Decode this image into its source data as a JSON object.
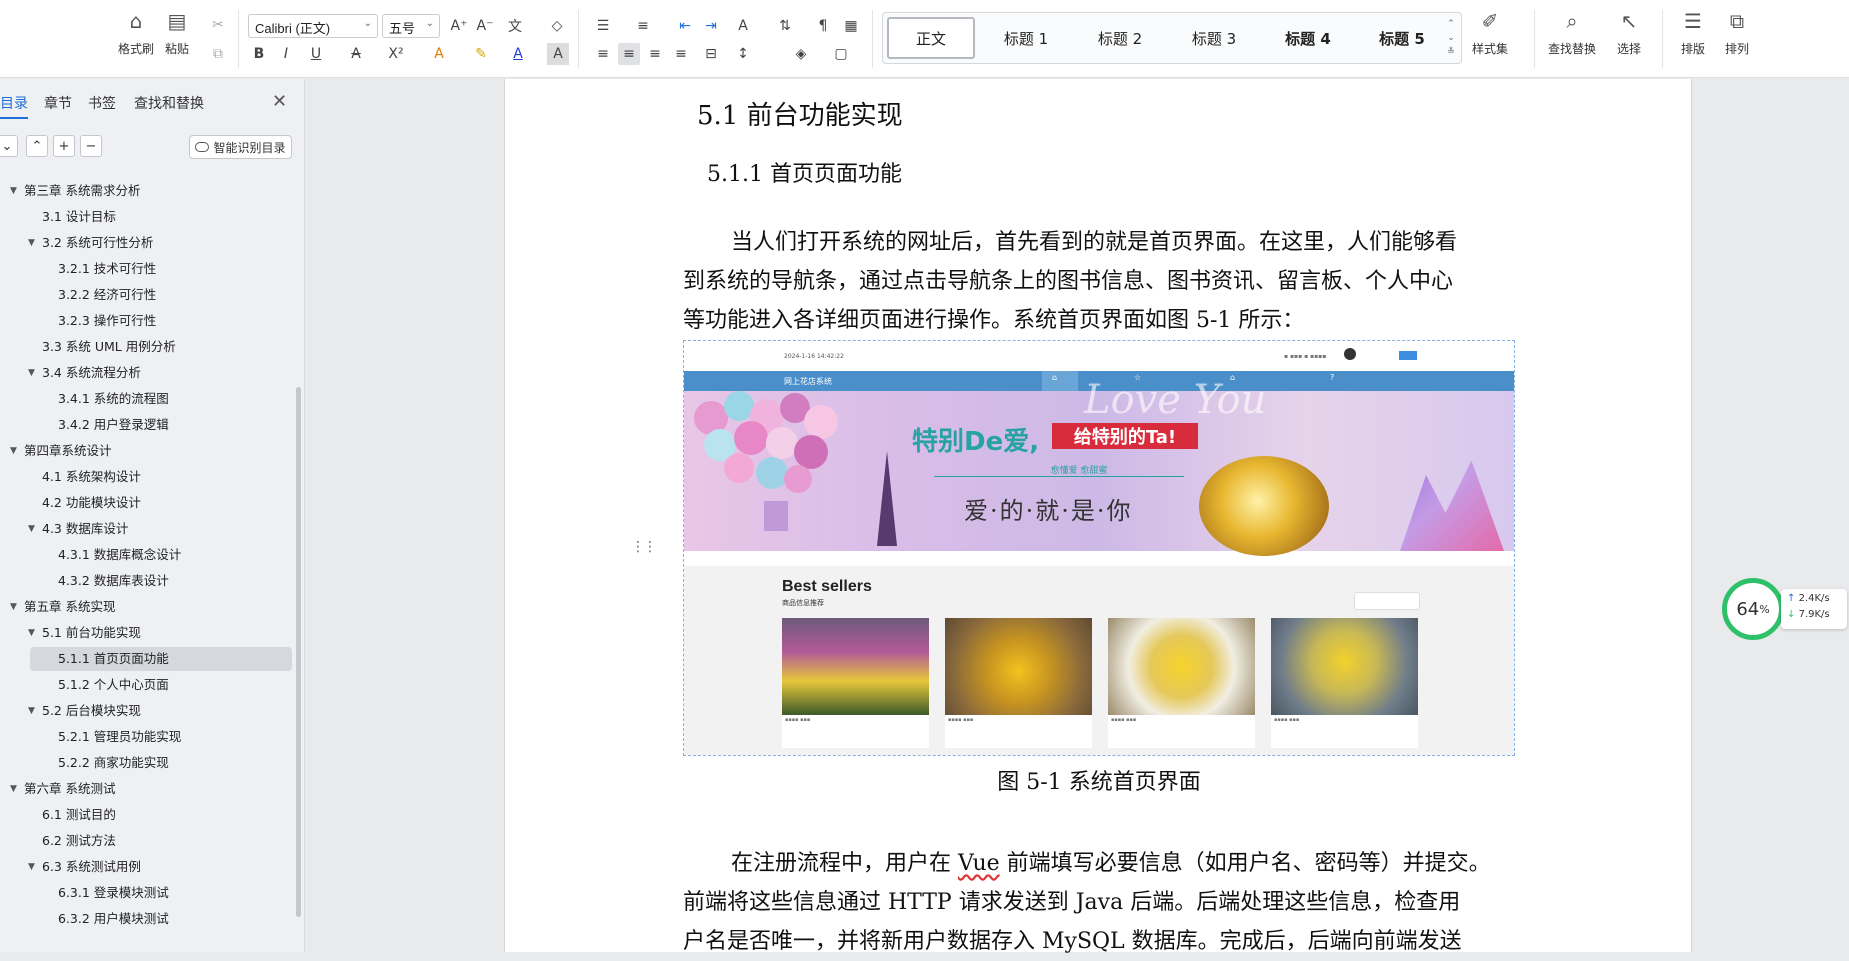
{
  "ribbon": {
    "format_painter": "格式刷",
    "paste": "粘贴",
    "font_name": "Calibri (正文)",
    "font_size": "五号",
    "styles": [
      "正文",
      "标题 1",
      "标题 2",
      "标题 3",
      "标题 4",
      "标题 5"
    ],
    "style_set": "样式集",
    "find_replace": "查找替换",
    "select": "选择",
    "layout": "排版",
    "arrange": "排列"
  },
  "nav": {
    "tabs": [
      "目录",
      "章节",
      "书签",
      "查找和替换"
    ],
    "smart_toc_button": "智能识别目录",
    "toc": [
      {
        "label": "第三章  系统需求分析",
        "level": 0,
        "expand": true
      },
      {
        "label": "3.1 设计目标",
        "level": 1,
        "expand": false
      },
      {
        "label": "3.2 系统可行性分析",
        "level": 1,
        "expand": true
      },
      {
        "label": "3.2.1 技术可行性",
        "level": 2,
        "expand": false
      },
      {
        "label": "3.2.2 经济可行性",
        "level": 2,
        "expand": false
      },
      {
        "label": "3.2.3 操作可行性",
        "level": 2,
        "expand": false
      },
      {
        "label": "3.3 系统 UML 用例分析",
        "level": 1,
        "expand": false
      },
      {
        "label": "3.4 系统流程分析",
        "level": 1,
        "expand": true
      },
      {
        "label": "3.4.1 系统的流程图",
        "level": 2,
        "expand": false
      },
      {
        "label": "3.4.2 用户登录逻辑",
        "level": 2,
        "expand": false
      },
      {
        "label": "第四章系统设计",
        "level": 0,
        "expand": true
      },
      {
        "label": "4.1  系统架构设计",
        "level": 1,
        "expand": false
      },
      {
        "label": "4.2 功能模块设计",
        "level": 1,
        "expand": false
      },
      {
        "label": "4.3  数据库设计",
        "level": 1,
        "expand": true
      },
      {
        "label": "4.3.1 数据库概念设计",
        "level": 2,
        "expand": false
      },
      {
        "label": "4.3.2  数据库表设计",
        "level": 2,
        "expand": false
      },
      {
        "label": "第五章  系统实现",
        "level": 0,
        "expand": true
      },
      {
        "label": "5.1 前台功能实现",
        "level": 1,
        "expand": true
      },
      {
        "label": "5.1.1 首页页面功能",
        "level": 2,
        "expand": false,
        "selected": true
      },
      {
        "label": "5.1.2 个人中心页面",
        "level": 2,
        "expand": false
      },
      {
        "label": "5.2 后台模块实现",
        "level": 1,
        "expand": true
      },
      {
        "label": "5.2.1 管理员功能实现",
        "level": 2,
        "expand": false
      },
      {
        "label": "5.2.2 商家功能实现",
        "level": 2,
        "expand": false
      },
      {
        "label": "第六章  系统测试",
        "level": 0,
        "expand": true
      },
      {
        "label": "6.1 测试目的",
        "level": 1,
        "expand": false
      },
      {
        "label": "6.2 测试方法",
        "level": 1,
        "expand": false
      },
      {
        "label": "6.3 系统测试用例",
        "level": 1,
        "expand": true
      },
      {
        "label": "6.3.1 登录模块测试",
        "level": 2,
        "expand": false
      },
      {
        "label": "6.3.2 用户模块测试",
        "level": 2,
        "expand": false
      }
    ]
  },
  "doc": {
    "h1": "5.1 前台功能实现",
    "h2": "5.1.1 首页页面功能",
    "para1_lines": [
      "当人们打开系统的网址后，首先看到的就是首页界面。在这里，人们能够看",
      "到系统的导航条，通过点击导航条上的图书信息、图书资讯、留言板、个人中心",
      "等功能进入各详细页面进行操作。系统首页界面如图 5-1 所示："
    ],
    "caption": "图 5-1  系统首页界面",
    "para2_line1_pre": "在注册流程中，用户在 ",
    "para2_line1_vue": "Vue",
    "para2_line1_post": " 前端填写必要信息（如用户名、密码等）并提交。",
    "para2_line2": "前端将这些信息通过 HTTP 请求发送到 Java 后端。后端处理这些信息，检查用",
    "para2_line3": "户名是否唯一，并将新用户数据存入 MySQL 数据库。完成后，后端向前端发送"
  },
  "figure": {
    "datetime": "2024-1-16 14:42:22",
    "site_title": "网上花店系统",
    "banner_script": "Love You",
    "banner_t1": "特别De爱,",
    "banner_t2": "给特别的Ta!",
    "banner_t3": "愈懂爱  愈甜蜜",
    "banner_t4": "爱·的·就·是·你",
    "best_sellers": "Best sellers",
    "best_sellers_sub": "商品信息推荐"
  },
  "perf": {
    "percent": "64",
    "percent_unit": "%",
    "up": "2.4K/s",
    "down": "7.9K/s"
  }
}
